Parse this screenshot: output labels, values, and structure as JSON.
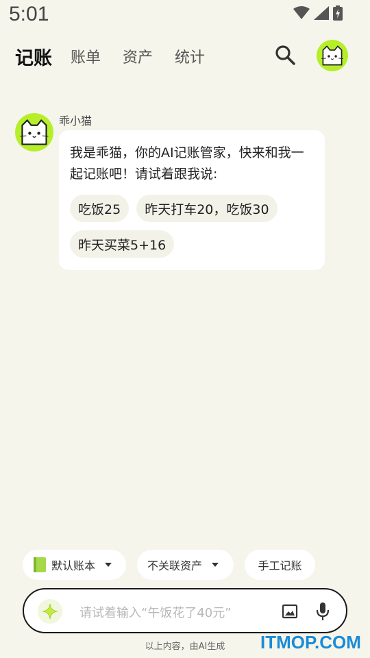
{
  "status_bar": {
    "time": "5:01",
    "icons": [
      "wifi-icon",
      "signal-icon",
      "battery-icon"
    ]
  },
  "nav": {
    "tabs": [
      {
        "label": "记账",
        "active": true
      },
      {
        "label": "账单",
        "active": false
      },
      {
        "label": "资产",
        "active": false
      },
      {
        "label": "统计",
        "active": false
      }
    ],
    "search_icon": "search-icon",
    "avatar_icon": "cat-avatar-icon"
  },
  "chat": {
    "bot_name": "乖小猫",
    "message": "我是乖猫，你的AI记账管家，快来和我一起记账吧！请试着跟我说:",
    "suggestions": [
      "吃饭25",
      "昨天打车20，吃饭30",
      "昨天买菜5+16"
    ]
  },
  "controls": {
    "account_book": "默认账本",
    "asset_link": "不关联资产",
    "manual_entry": "手工记账"
  },
  "input": {
    "placeholder": "请试着输入“午饭花了40元”",
    "icons": [
      "sparkle-icon",
      "image-icon",
      "mic-icon"
    ]
  },
  "footer": {
    "note": "以上内容，由AI生成"
  },
  "watermark": "ITMOP.COM",
  "colors": {
    "accent_green": "#b6ef2a",
    "background": "#f5f5ec",
    "watermark_blue": "#1a8bd6"
  }
}
